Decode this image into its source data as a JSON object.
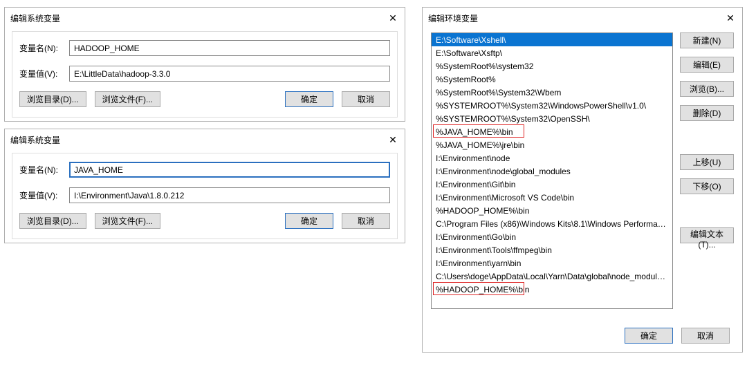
{
  "dialog1": {
    "title": "编辑系统变量",
    "name_label": "变量名(N):",
    "name_value": "HADOOP_HOME",
    "value_label": "变量值(V):",
    "value_value": "E:\\LittleData\\hadoop-3.3.0",
    "browse_dir": "浏览目录(D)...",
    "browse_file": "浏览文件(F)...",
    "ok": "确定",
    "cancel": "取消"
  },
  "dialog2": {
    "title": "编辑系统变量",
    "name_label": "变量名(N):",
    "name_value": "JAVA_HOME",
    "value_label": "变量值(V):",
    "value_value": "I:\\Environment\\Java\\1.8.0.212",
    "browse_dir": "浏览目录(D)...",
    "browse_file": "浏览文件(F)...",
    "ok": "确定",
    "cancel": "取消"
  },
  "envDialog": {
    "title": "编辑环境变量",
    "items": [
      "E:\\Software\\Xshell\\",
      "E:\\Software\\Xsftp\\",
      "%SystemRoot%\\system32",
      "%SystemRoot%",
      "%SystemRoot%\\System32\\Wbem",
      "%SYSTEMROOT%\\System32\\WindowsPowerShell\\v1.0\\",
      "%SYSTEMROOT%\\System32\\OpenSSH\\",
      "%JAVA_HOME%\\bin",
      "%JAVA_HOME%\\jre\\bin",
      "I:\\Environment\\node",
      "I:\\Environment\\node\\global_modules",
      "I:\\Environment\\Git\\bin",
      "I:\\Environment\\Microsoft VS Code\\bin",
      "%HADOOP_HOME%\\bin",
      "C:\\Program Files (x86)\\Windows Kits\\8.1\\Windows Performance...",
      "I:\\Environment\\Go\\bin",
      "I:\\Environment\\Tools\\ffmpeg\\bin",
      "I:\\Environment\\yarn\\bin",
      "C:\\Users\\doge\\AppData\\Local\\Yarn\\Data\\global\\node_modules...",
      "%HADOOP_HOME%\\bin"
    ],
    "btn_new": "新建(N)",
    "btn_edit": "编辑(E)",
    "btn_browse": "浏览(B)...",
    "btn_delete": "删除(D)",
    "btn_up": "上移(U)",
    "btn_down": "下移(O)",
    "btn_edit_text": "编辑文本(T)...",
    "ok": "确定",
    "cancel": "取消"
  }
}
